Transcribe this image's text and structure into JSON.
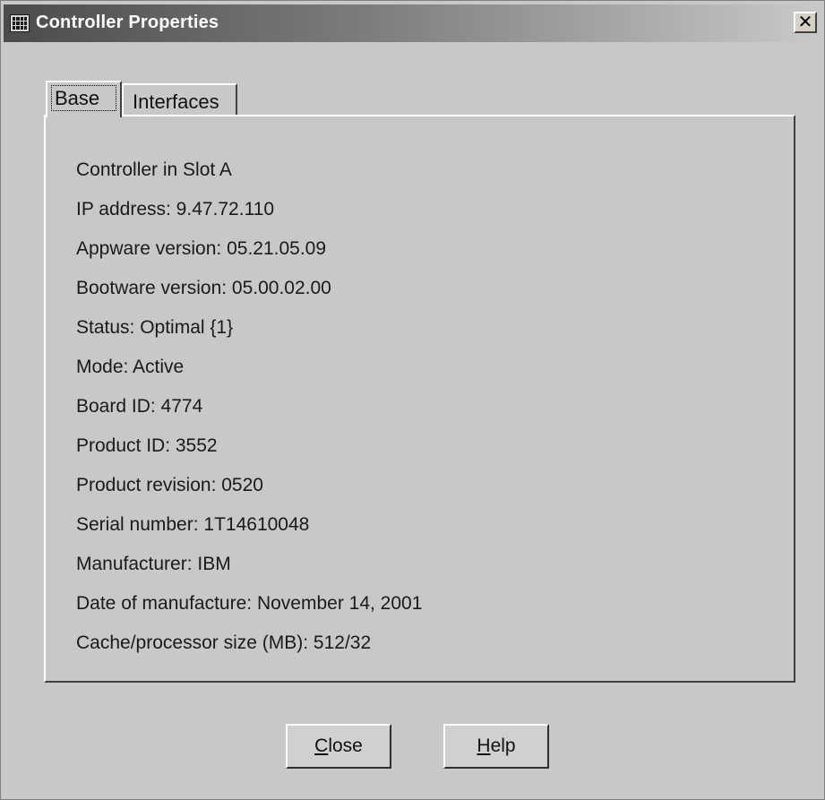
{
  "window": {
    "title": "Controller Properties",
    "close_glyph": "✕"
  },
  "tabs": [
    {
      "label": "Base",
      "selected": true
    },
    {
      "label": "Interfaces",
      "selected": false
    }
  ],
  "properties": [
    "Controller in Slot A",
    "IP address: 9.47.72.110",
    "Appware version: 05.21.05.09",
    "Bootware version: 05.00.02.00",
    "Status: Optimal {1}",
    "Mode: Active",
    "Board ID: 4774",
    "Product ID: 3552",
    "Product revision: 0520",
    "Serial number: 1T14610048",
    "Manufacturer: IBM",
    "Date of manufacture: November 14, 2001",
    "Cache/processor size (MB): 512/32"
  ],
  "buttons": {
    "close": {
      "mnemonic": "C",
      "rest": "lose"
    },
    "help": {
      "mnemonic": "H",
      "rest": "elp"
    }
  }
}
